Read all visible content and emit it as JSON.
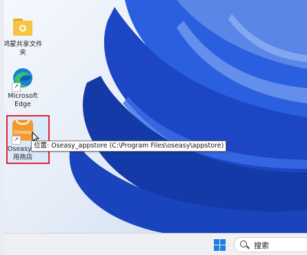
{
  "desktop": {
    "icons": [
      {
        "label": "鸿蒙共享文件夹",
        "icon": "folder-icon"
      },
      {
        "label": "Microsoft Edge",
        "icon": "edge-icon"
      },
      {
        "label": "Oseasy应用商店",
        "icon": "oseasy-appstore-icon",
        "selected": true,
        "badge": "Oseasy"
      }
    ],
    "tooltip": "位置: Oseasy_appstore (C:\\Program Files\\oseasy\\appstore)"
  },
  "taskbar": {
    "start_icon": "windows-start-icon",
    "search_placeholder": "搜索"
  },
  "colors": {
    "accent": "#1d7fe0",
    "wallpaper_blue": "#1f4fd1",
    "selection_border": "#e0242a"
  }
}
